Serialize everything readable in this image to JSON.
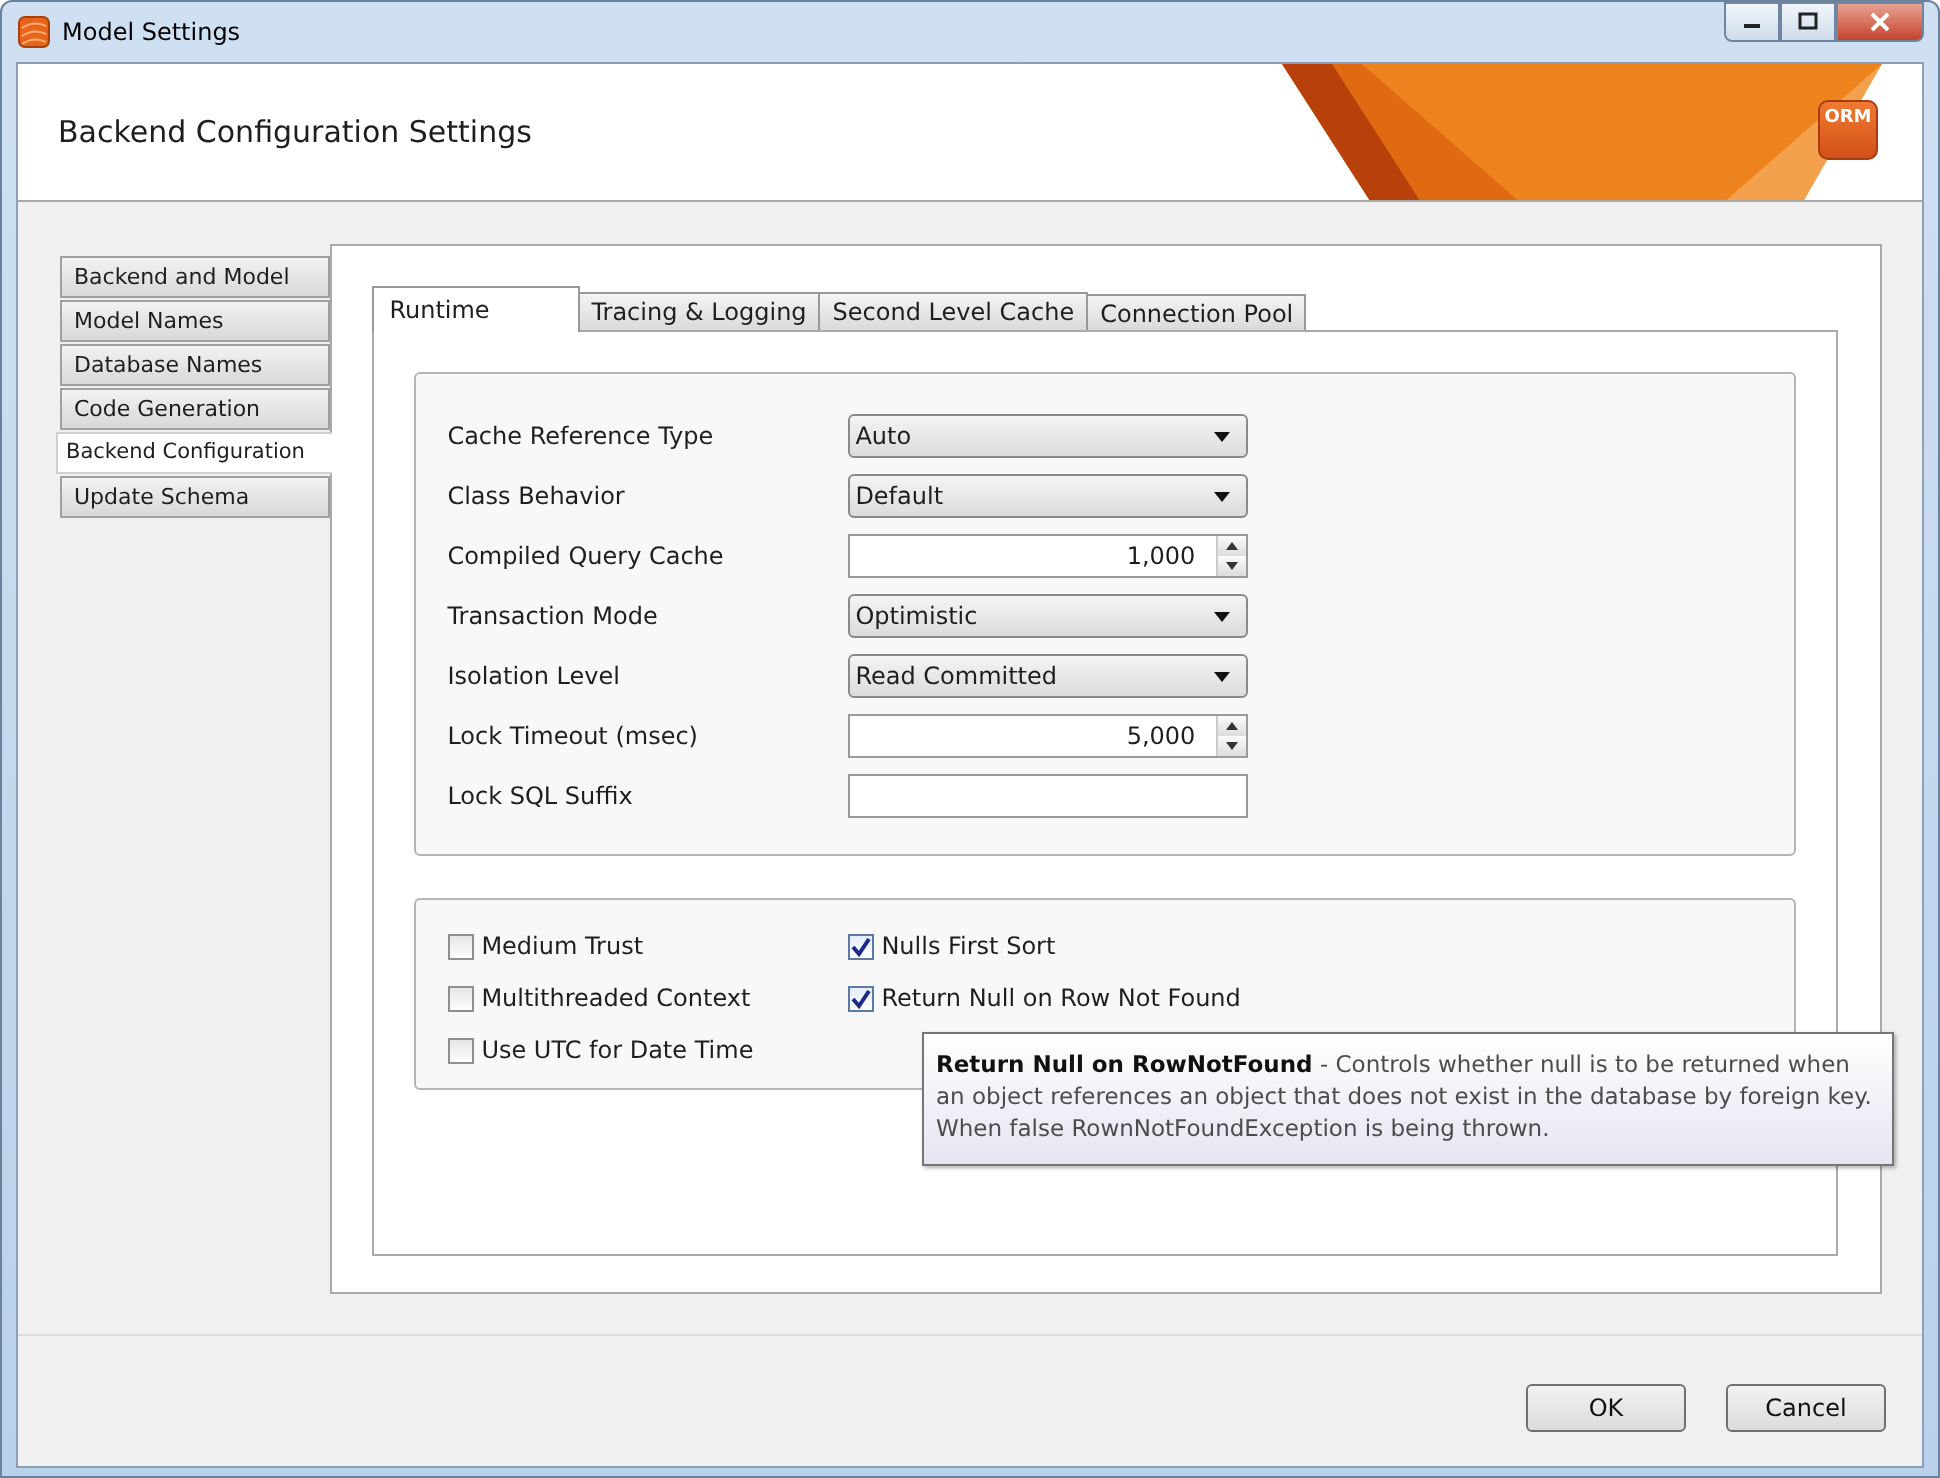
{
  "window": {
    "title": "Model Settings"
  },
  "header": {
    "title": "Backend Configuration Settings",
    "logo": "ORM"
  },
  "sidebar": {
    "items": [
      {
        "label": "Backend and Model",
        "selected": false
      },
      {
        "label": "Model Names",
        "selected": false
      },
      {
        "label": "Database Names",
        "selected": false
      },
      {
        "label": "Code Generation",
        "selected": false
      },
      {
        "label": "Backend Configuration",
        "selected": true
      },
      {
        "label": "Update Schema",
        "selected": false
      }
    ]
  },
  "tabs": [
    {
      "label": "Runtime",
      "selected": true
    },
    {
      "label": "Tracing & Logging",
      "selected": false
    },
    {
      "label": "Second Level Cache",
      "selected": false
    },
    {
      "label": "Connection Pool",
      "selected": false
    }
  ],
  "fields": [
    {
      "label": "Cache Reference Type",
      "kind": "dropdown",
      "value": "Auto"
    },
    {
      "label": "Class Behavior",
      "kind": "dropdown",
      "value": "Default"
    },
    {
      "label": "Compiled Query Cache",
      "kind": "spinner",
      "value": "1,000"
    },
    {
      "label": "Transaction Mode",
      "kind": "dropdown",
      "value": "Optimistic"
    },
    {
      "label": "Isolation Level",
      "kind": "dropdown",
      "value": "Read Committed"
    },
    {
      "label": "Lock Timeout (msec)",
      "kind": "spinner",
      "value": "5,000"
    },
    {
      "label": "Lock SQL Suffix",
      "kind": "text"
    }
  ],
  "checkbox_columns": [
    [
      {
        "label": "Medium Trust",
        "checked": false
      },
      {
        "label": "Multithreaded Context",
        "checked": false
      },
      {
        "label": "Use UTC for Date Time",
        "checked": false
      }
    ],
    [
      {
        "label": "Nulls First Sort",
        "checked": true
      },
      {
        "label": "Return Null on Row Not Found",
        "checked": true
      }
    ]
  ],
  "tooltip": {
    "text": "**Return Null on RowNotFound**  -  Controls whether null is to be returned when an object references an object that does not exist in the database by foreign key. When false RownNotFoundException is being thrown."
  },
  "buttons": [
    "OK",
    "Cancel"
  ]
}
